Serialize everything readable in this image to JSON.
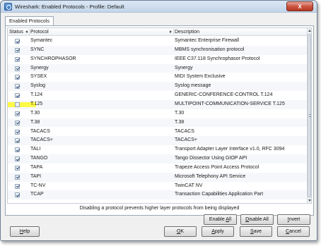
{
  "window": {
    "title": "Wireshark: Enabled Protocols - Profile: Default",
    "close_label": "X"
  },
  "tabs": [
    {
      "label": "Enabled Protocols"
    }
  ],
  "table": {
    "columns": {
      "status": "Status",
      "protocol": "Protocol",
      "description": "Description"
    },
    "rows": [
      {
        "protocol": "Symantec",
        "description": "Symantec Enterprise Firewall",
        "enabled": true
      },
      {
        "protocol": "SYNC",
        "description": "MBMS synchronisation protocol",
        "enabled": true
      },
      {
        "protocol": "SYNCHROPHASOR",
        "description": "IEEE C37.118 Synchrophasor Protocol",
        "enabled": true
      },
      {
        "protocol": "Synergy",
        "description": "Synergy",
        "enabled": true
      },
      {
        "protocol": "SYSEX",
        "description": "MIDI System Exclusive",
        "enabled": true
      },
      {
        "protocol": "Syslog",
        "description": "Syslog message",
        "enabled": true
      },
      {
        "protocol": "T.124",
        "description": "GENERIC-CONFERENCE-CONTROL T.124",
        "enabled": true
      },
      {
        "protocol": "T.125",
        "description": "MULTIPOINT-COMMUNICATION-SERVICE T.125",
        "enabled": false
      },
      {
        "protocol": "T.30",
        "description": "T.30",
        "enabled": true
      },
      {
        "protocol": "T.38",
        "description": "T.38",
        "enabled": true
      },
      {
        "protocol": "TACACS",
        "description": "TACACS",
        "enabled": true
      },
      {
        "protocol": "TACACS+",
        "description": "TACACS+",
        "enabled": true
      },
      {
        "protocol": "TALI",
        "description": "Transport Adapter Layer Interface v1.0, RFC 3094",
        "enabled": true
      },
      {
        "protocol": "TANGO",
        "description": "Tango Dissector Using GIOP API",
        "enabled": true
      },
      {
        "protocol": "TAPA",
        "description": "Trapeze Access Point Access Protocol",
        "enabled": true
      },
      {
        "protocol": "TAPI",
        "description": "Microsoft Telephony API Service",
        "enabled": true
      },
      {
        "protocol": "TC-NV",
        "description": "TwinCAT NV",
        "enabled": true
      },
      {
        "protocol": "TCAP",
        "description": "Transaction Capabilities Application Part",
        "enabled": true
      }
    ]
  },
  "note": "Disabling a protocol prevents higher layer protocols from being displayed",
  "buttons": {
    "enable_all": {
      "pre": "Enable ",
      "key": "A",
      "post": "ll"
    },
    "disable_all": {
      "pre": "",
      "key": "D",
      "post": "isable All"
    },
    "invert": {
      "pre": "",
      "key": "I",
      "post": "nvert"
    },
    "help": {
      "pre": "",
      "key": "H",
      "post": "elp"
    },
    "ok": {
      "pre": "",
      "key": "O",
      "post": "K"
    },
    "apply": {
      "pre": "",
      "key": "A",
      "post": "pply"
    },
    "save": {
      "pre": "",
      "key": "S",
      "post": "ave"
    },
    "cancel": {
      "pre": "",
      "key": "C",
      "post": "ancel"
    }
  },
  "colors": {
    "highlight": "#fff830",
    "checkmark": "#2b4a78"
  }
}
